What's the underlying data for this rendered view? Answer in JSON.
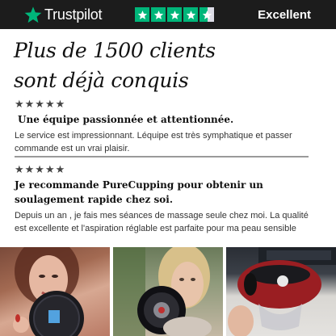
{
  "trustpilot": {
    "brand": "Trustpilot",
    "rating_label": "Excellent",
    "stars_filled": 4.5,
    "stars_total": 5,
    "brand_color": "#00b67a"
  },
  "headline": {
    "line1": "Plus de 1500 clients",
    "line2": "sont déjà conquis"
  },
  "reviews": [
    {
      "stars": "★★★★★",
      "title": "Une équipe passionnée et attentionnée.",
      "body": "Le service est impressionnant. Léquipe est très symphatique et passer commande est un vrai plaisir."
    },
    {
      "stars": "★★★★★",
      "title": "Je recommande PureCupping pour obtenir un soulagement rapide chez soi.",
      "body": "Depuis un an , je fais mes séances de massage seule chez moi. La qualité est excellente et l'aspiration réglable est parfaite pour ma peau sensible"
    }
  ],
  "photos": [
    {
      "icon": "woman-holding-device-photo"
    },
    {
      "icon": "woman-holding-cup-photo"
    },
    {
      "icon": "cupping-device-in-hand-photo"
    }
  ]
}
